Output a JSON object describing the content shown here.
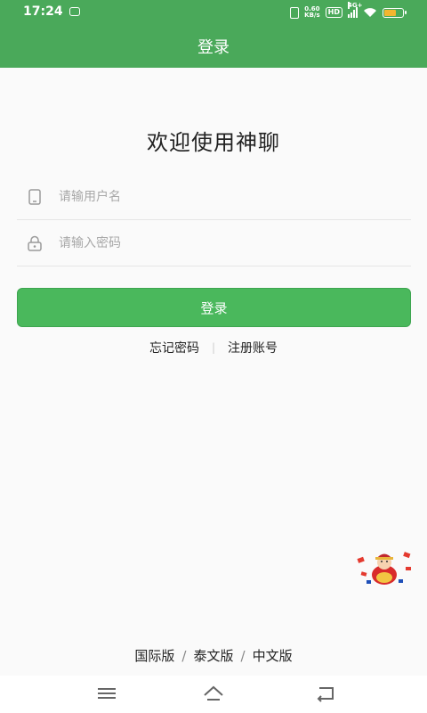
{
  "status_bar": {
    "time": "17:24",
    "net_speed_value": "0.60",
    "net_speed_unit": "KB/s",
    "hd_label": "HD",
    "signal_label": "4G+",
    "battery_level": 0.58
  },
  "header": {
    "title": "登录"
  },
  "main": {
    "welcome": "欢迎使用神聊",
    "username": {
      "placeholder": "请输用户名",
      "value": ""
    },
    "password": {
      "placeholder": "请输入密码",
      "value": ""
    },
    "login_label": "登录",
    "forgot_label": "忘记密码",
    "separator": "|",
    "register_label": "注册账号"
  },
  "footer": {
    "versions": [
      "国际版",
      "泰文版",
      "中文版"
    ],
    "slash": "/"
  },
  "colors": {
    "accent": "#4aa95a",
    "button": "#4ab85c"
  }
}
